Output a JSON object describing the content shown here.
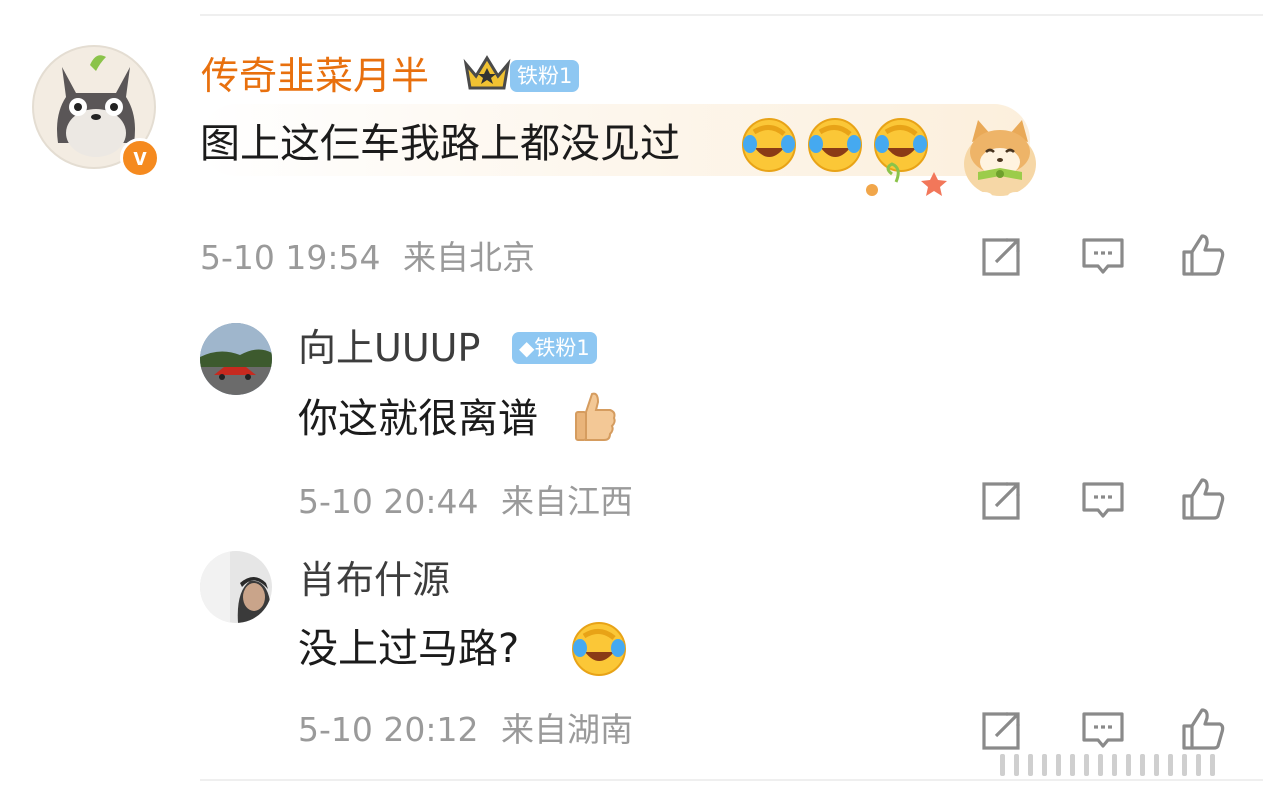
{
  "comments": [
    {
      "author": "传奇韭菜月半",
      "badge": "铁粉1",
      "text": "图上这仨车我路上都没见过",
      "time": "5-10 19:54",
      "location": "来自北京"
    },
    {
      "author": "向上UUUP",
      "badge": "铁粉1",
      "text": "你这就很离谱",
      "time": "5-10 20:44",
      "location": "来自江西"
    },
    {
      "author": "肖布什源",
      "text": "没上过马路?",
      "time": "5-10 20:12",
      "location": "来自湖南"
    }
  ],
  "colors": {
    "vip_name": "#e8700e",
    "badge_bg": "#8ec7f2",
    "meta_text": "#9a9a9a",
    "icon_stroke": "#8a8a8a"
  },
  "icons": {
    "actions": [
      "share-icon",
      "comment-icon",
      "like-icon"
    ],
    "emoji": [
      "laugh-cry-emoji",
      "thumbs-up-emoji",
      "shiba-dog-sticker"
    ]
  }
}
